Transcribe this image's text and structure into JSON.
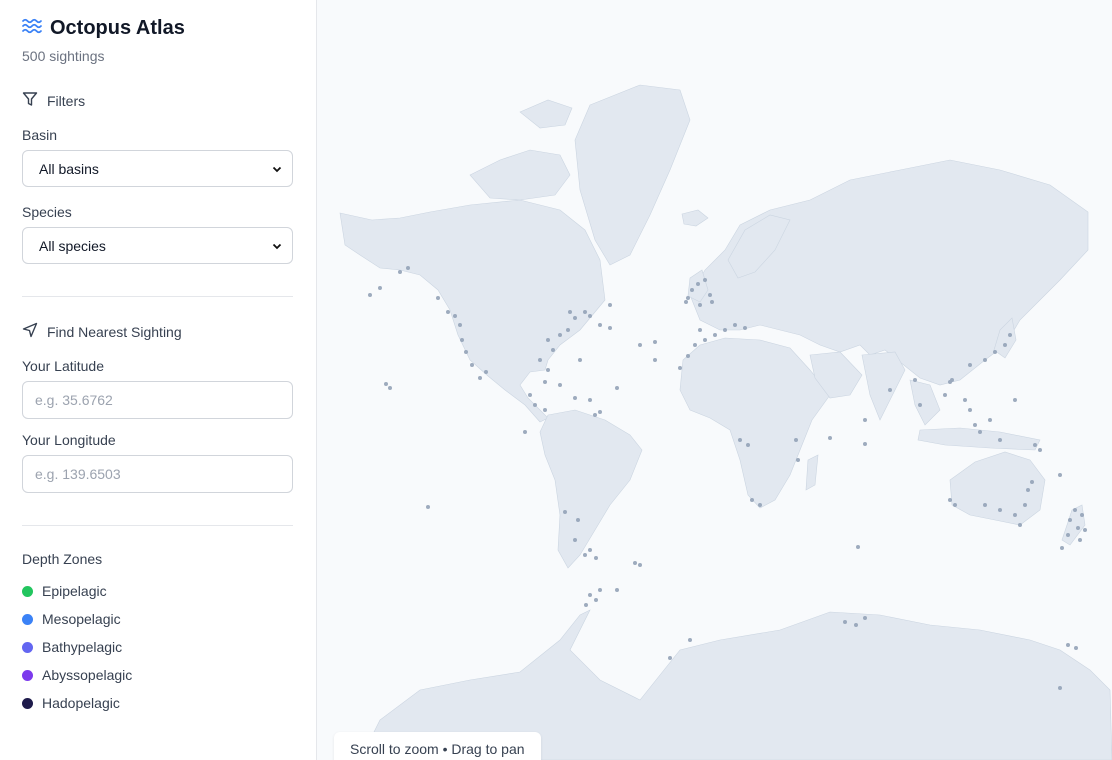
{
  "app": {
    "title": "Octopus Atlas",
    "subtitle": "500 sightings",
    "icon": "waves-icon"
  },
  "filters": {
    "heading": "Filters",
    "basin": {
      "label": "Basin",
      "value": "All basins"
    },
    "species": {
      "label": "Species",
      "value": "All species"
    }
  },
  "nearest": {
    "heading": "Find Nearest Sighting",
    "latitude": {
      "label": "Your Latitude",
      "placeholder": "e.g. 35.6762"
    },
    "longitude": {
      "label": "Your Longitude",
      "placeholder": "e.g. 139.6503"
    }
  },
  "legend": {
    "title": "Depth Zones",
    "items": [
      {
        "label": "Epipelagic",
        "color": "#22c55e"
      },
      {
        "label": "Mesopelagic",
        "color": "#3b82f6"
      },
      {
        "label": "Bathypelagic",
        "color": "#6366f1"
      },
      {
        "label": "Abyssopelagic",
        "color": "#7c3aed"
      },
      {
        "label": "Hadopelagic",
        "color": "#1e1b4b"
      }
    ]
  },
  "map": {
    "hint": "Scroll to zoom • Drag to pan",
    "land_color": "#e2e8f0",
    "ocean_color": "#f8fafc",
    "marker_color": "#94a3b8"
  }
}
